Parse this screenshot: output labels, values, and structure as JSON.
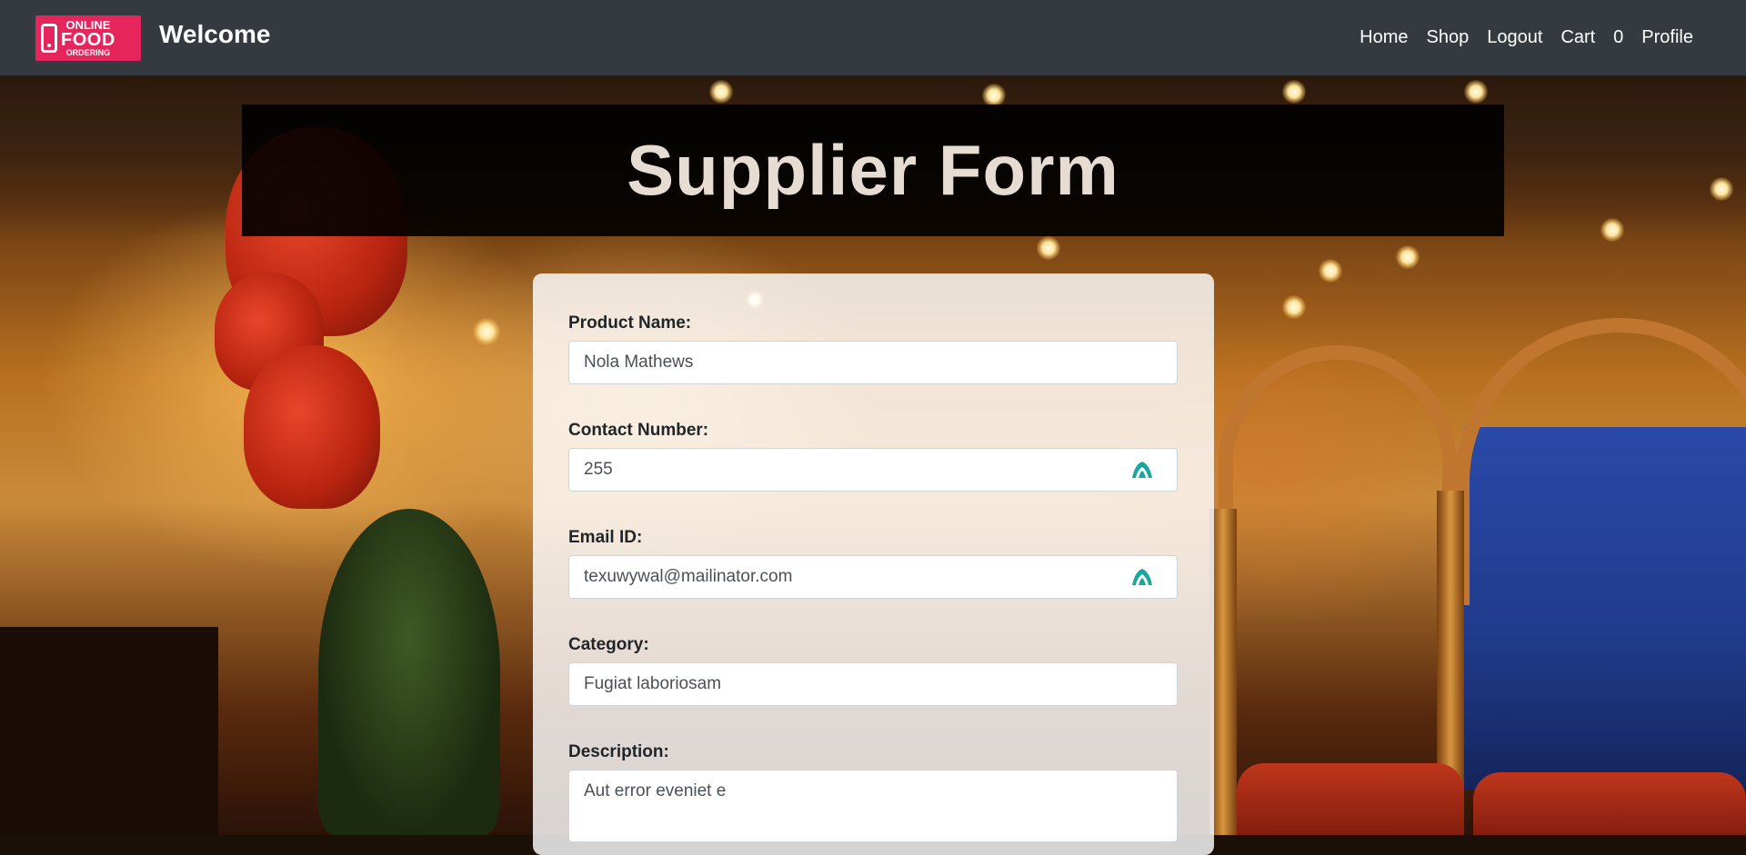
{
  "navbar": {
    "logo": {
      "line1": "ONLINE",
      "line2": "FOOD",
      "line3": "ORDERING"
    },
    "brand": "Welcome",
    "links": [
      "Home",
      "Shop",
      "Logout",
      "Cart",
      "0",
      "Profile"
    ]
  },
  "page_title": "Supplier Form",
  "form": {
    "product_name": {
      "label": "Product Name:",
      "value": "Nola Mathews"
    },
    "contact_number": {
      "label": "Contact Number:",
      "value": "255"
    },
    "email": {
      "label": "Email ID:",
      "value": "texuwywal@mailinator.com"
    },
    "category": {
      "label": "Category:",
      "value": "Fugiat laboriosam"
    },
    "description": {
      "label": "Description:",
      "value": "Aut error eveniet e"
    }
  },
  "colors": {
    "navbar_bg": "#343a40",
    "logo_bg": "#e5255c",
    "autofill_icon": "#1aa7a0"
  }
}
